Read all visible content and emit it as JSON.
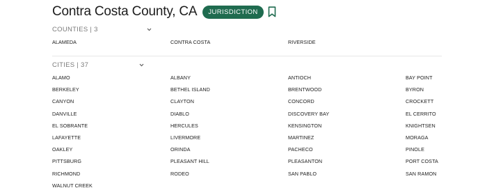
{
  "header": {
    "title": "Contra Costa County, CA",
    "badge": "JURISDICTION",
    "bookmark_icon": "bookmark-icon",
    "accent_color": "#1f6b4f"
  },
  "counties": {
    "title": "COUNTIES | 3",
    "chevron_icon": "chevron-down-icon",
    "items": [
      "ALAMEDA",
      "CONTRA COSTA",
      "RIVERSIDE"
    ]
  },
  "cities": {
    "title": "CITIES | 37",
    "chevron_icon": "chevron-down-icon",
    "items": [
      "ALAMO",
      "ALBANY",
      "ANTIOCH",
      "BAY POINT",
      "BERKELEY",
      "BETHEL ISLAND",
      "BRENTWOOD",
      "BYRON",
      "CANYON",
      "CLAYTON",
      "CONCORD",
      "CROCKETT",
      "DANVILLE",
      "DIABLO",
      "DISCOVERY BAY",
      "EL CERRITO",
      "EL SOBRANTE",
      "HERCULES",
      "KENSINGTON",
      "KNIGHTSEN",
      "LAFAYETTE",
      "LIVERMORE",
      "MARTINEZ",
      "MORAGA",
      "OAKLEY",
      "ORINDA",
      "PACHECO",
      "PINOLE",
      "PITTSBURG",
      "PLEASANT HILL",
      "PLEASANTON",
      "PORT COSTA",
      "RICHMOND",
      "RODEO",
      "SAN PABLO",
      "SAN RAMON",
      "WALNUT CREEK"
    ]
  }
}
